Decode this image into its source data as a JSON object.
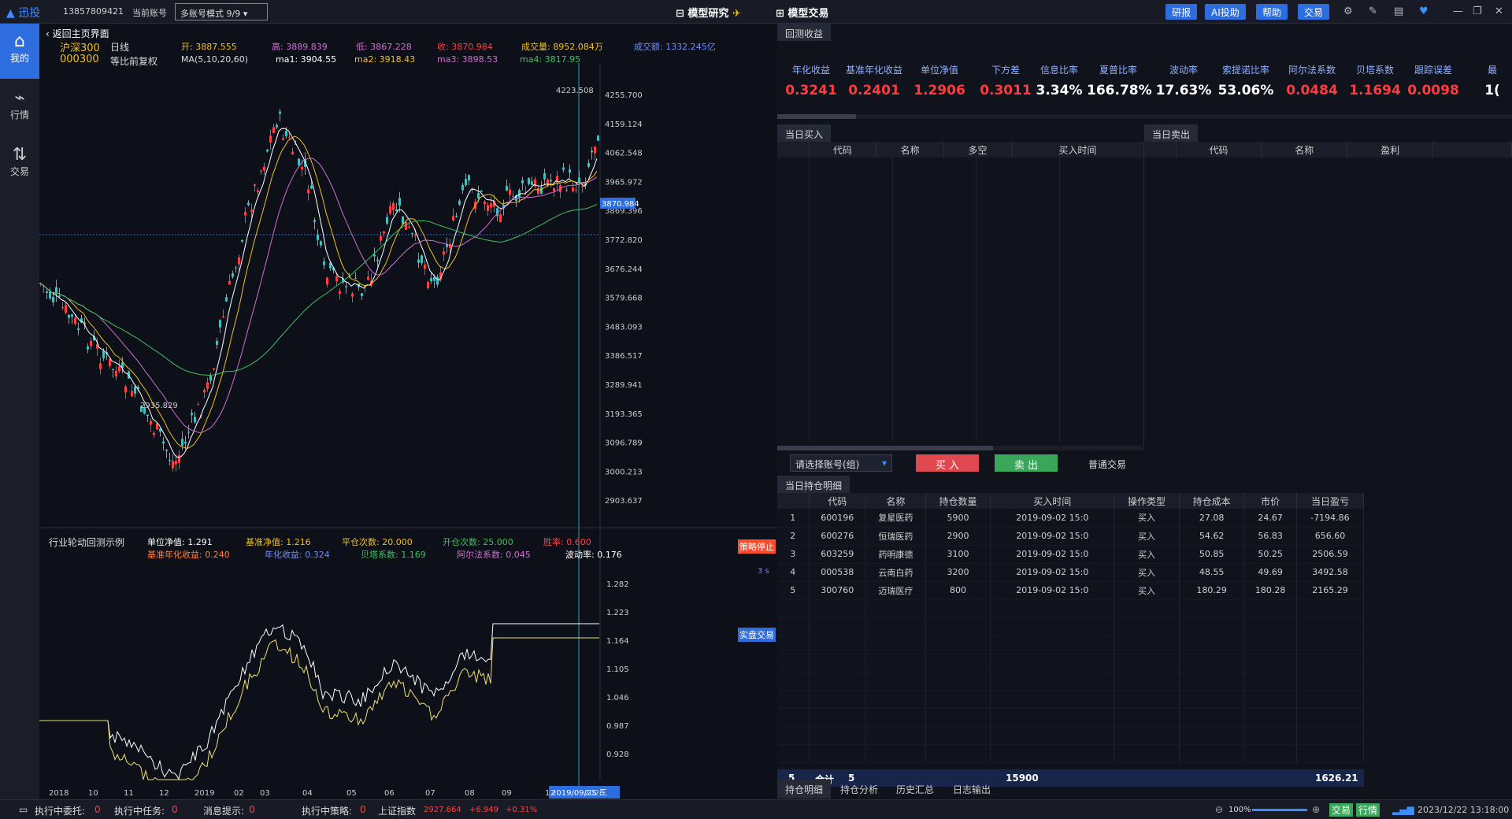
{
  "topbar": {
    "app": "迅投",
    "account": "13857809421",
    "current_account_label": "当前账号",
    "account_mode": "多账号模式 9/9",
    "model_research": "模型研究",
    "model_trade": "模型交易",
    "buttons": [
      "研报",
      "AI投助",
      "帮助",
      "交易"
    ]
  },
  "sidebar": [
    {
      "label": "我的",
      "icon": "home-icon"
    },
    {
      "label": "行情",
      "icon": "chart-icon"
    },
    {
      "label": "交易",
      "icon": "trade-icon"
    }
  ],
  "chart": {
    "back": "返回主页界面",
    "name": "沪深300",
    "code": "000300",
    "period": "日线",
    "adjust": "等比前复权",
    "ma_label": "MA(5,10,20,60)",
    "open": "开: 3887.555",
    "high": "高: 3889.839",
    "low": "低: 3867.228",
    "close": "收: 3870.984",
    "volume": "成交量: 8952.084万",
    "amount": "成交额: 1332.245亿",
    "ma1": "ma1: 3904.55",
    "ma2": "ma2: 3918.43",
    "ma3": "ma3: 3898.53",
    "ma4": "ma4: 3817.95",
    "yticks": [
      "4255.700",
      "4159.124",
      "4062.548",
      "3965.972",
      "3869.396",
      "3772.820",
      "3676.244",
      "3579.668",
      "3483.093",
      "3386.517",
      "3289.941",
      "3193.365",
      "3096.789",
      "3000.213",
      "2903.637"
    ],
    "current_price": "3870.984",
    "high_label": "4223.508",
    "low_label": "2935.829",
    "xticks": [
      "2018",
      "10",
      "11",
      "12",
      "2019",
      "02",
      "03",
      "04",
      "05",
      "06",
      "07",
      "08",
      "09",
      "2019/09/25 三",
      "12",
      "2020"
    ]
  },
  "strategy": {
    "name": "行业轮动回测示例",
    "nav": "单位净值: 1.291",
    "bench_nav": "基准净值: 1.216",
    "open_count": "开仓次数: 25.000",
    "close_count": "平仓次数: 20.000",
    "win_rate": "胜率: 0.600",
    "bench_annual": "基准年化收益: 0.240",
    "annual": "年化收益: 0.324",
    "beta": "贝塔系数: 1.169",
    "alpha": "阿尔法系数: 0.045",
    "volatility": "波动率: 0.176",
    "stop_tag": "策略停止",
    "live_tag": "实盘交易",
    "secs": "3 s",
    "yticks": [
      "1.282",
      "1.223",
      "1.164",
      "1.105",
      "1.046",
      "0.987",
      "0.928"
    ]
  },
  "backtest": {
    "tab": "回测收益",
    "metrics": [
      {
        "label": "年化收益",
        "value": "0.3241",
        "color": "#ff3b3b"
      },
      {
        "label": "基准年化收益",
        "value": "0.2401",
        "color": "#ff3b3b"
      },
      {
        "label": "单位净值",
        "value": "1.2906",
        "color": "#ff3b3b"
      },
      {
        "label": "下方差",
        "value": "0.3011",
        "color": "#ff3b3b"
      },
      {
        "label": "信息比率",
        "value": "3.34%",
        "color": "#ffffff"
      },
      {
        "label": "夏普比率",
        "value": "166.78%",
        "color": "#ffffff"
      },
      {
        "label": "波动率",
        "value": "17.63%",
        "color": "#ffffff"
      },
      {
        "label": "索提诺比率",
        "value": "53.06%",
        "color": "#ffffff"
      },
      {
        "label": "阿尔法系数",
        "value": "0.0484",
        "color": "#ff3b3b"
      },
      {
        "label": "贝塔系数",
        "value": "1.1694",
        "color": "#ff3b3b"
      },
      {
        "label": "跟踪误差",
        "value": "0.0098",
        "color": "#ff3b3b"
      },
      {
        "label": "最",
        "value": "1(",
        "color": "#ffffff"
      }
    ]
  },
  "buy_panel": {
    "tab": "当日买入",
    "cols": [
      "代码",
      "名称",
      "多空",
      "买入时间"
    ]
  },
  "sell_panel": {
    "tab": "当日卖出",
    "cols": [
      "代码",
      "名称",
      "盈利"
    ]
  },
  "order": {
    "select": "请选择账号(组)",
    "buy": "买 入",
    "sell": "卖 出",
    "normal": "普通交易"
  },
  "holdings": {
    "tab": "当日持仓明细",
    "cols": [
      "代码",
      "名称",
      "持仓数量",
      "买入时间",
      "操作类型",
      "持仓成本",
      "市价",
      "当日盈亏"
    ],
    "rows": [
      [
        "1",
        "600196",
        "复星医药",
        "5900",
        "2019-09-02 15:0",
        "买入",
        "27.08",
        "24.67",
        "-7194.86"
      ],
      [
        "2",
        "600276",
        "恒瑞医药",
        "2900",
        "2019-09-02 15:0",
        "买入",
        "54.62",
        "56.83",
        "656.60"
      ],
      [
        "3",
        "603259",
        "药明康德",
        "3100",
        "2019-09-02 15:0",
        "买入",
        "50.85",
        "50.25",
        "2506.59"
      ],
      [
        "4",
        "000538",
        "云南白药",
        "3200",
        "2019-09-02 15:0",
        "买入",
        "48.55",
        "49.69",
        "3492.58"
      ],
      [
        "5",
        "300760",
        "迈瑞医疗",
        "800",
        "2019-09-02 15:0",
        "买入",
        "180.29",
        "180.28",
        "2165.29"
      ]
    ],
    "total": {
      "count": "5",
      "label": "合计",
      "n": "5",
      "qty": "15900",
      "pnl": "1626.21"
    }
  },
  "bottom_tabs": [
    "持仓明细",
    "持仓分析",
    "历史汇总",
    "日志输出"
  ],
  "status": {
    "entrust": "执行中委托:",
    "entrust_v": "0",
    "task": "执行中任务:",
    "task_v": "0",
    "msg": "消息提示:",
    "msg_v": "0",
    "strat": "执行中策略:",
    "strat_v": "0",
    "index": "上证指数",
    "index_v": "2927.664",
    "index_chg": "+6.949",
    "index_pct": "+0.31%",
    "zoom": "100%",
    "trade": "交易",
    "quote": "行情",
    "datetime": "2023/12/22 13:18:00"
  }
}
